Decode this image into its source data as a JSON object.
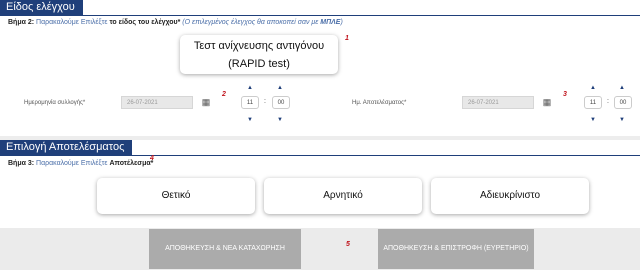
{
  "section1": {
    "title": "Είδος ελέγχου",
    "step_label": "Βήμα 2:",
    "step_text": " Παρακαλούμε Επιλέξτε ",
    "step_bold": "το είδος του ελέγχου*",
    "step_note": " (Ο επιλεγμένος έλεγχος θα αποκοπεί σαν με ",
    "step_note_bold": "ΜΠΛΕ",
    "step_note_end": ")",
    "marker1": "1",
    "test_button_line1": "Τεστ ανίχνευσης αντιγόνου",
    "test_button_line2": "(RAPID test)",
    "collection_label": "Ημερομηνία συλλογής*",
    "collection_date": "26-07-2021",
    "marker2": "2",
    "collection_hour": "11",
    "collection_minute": "00",
    "result_label": "Ημ. Αποτελέσματος*",
    "result_date": "26-07-2021",
    "marker3": "3",
    "result_hour": "11",
    "result_minute": "00"
  },
  "section2": {
    "title": "Επιλογή Αποτελέσματος",
    "step_label": "Βήμα 3:",
    "step_text": " Παρακαλούμε Επιλέξτε ",
    "step_bold": "Αποτέλεσμα*",
    "marker4": "4",
    "buttons": [
      "Θετικό",
      "Αρνητικό",
      "Αδιευκρίνιστο"
    ]
  },
  "footer": {
    "save_new_label": "ΑΠΟΘΗΚΕΥΣΗ & ΝΕΑ ΚΑΤΑΧΩΡΗΣΗ",
    "marker5": "5",
    "save_return_label": "ΑΠΟΘΗΚΕΥΣΗ & ΕΠΙΣΤΡΟΦΗ (ΕΥΡΕΤΗΡΙΟ)"
  },
  "colors": {
    "header": "#1f3f7a",
    "marker": "#c0121b",
    "disabled_button": "#ababab"
  }
}
